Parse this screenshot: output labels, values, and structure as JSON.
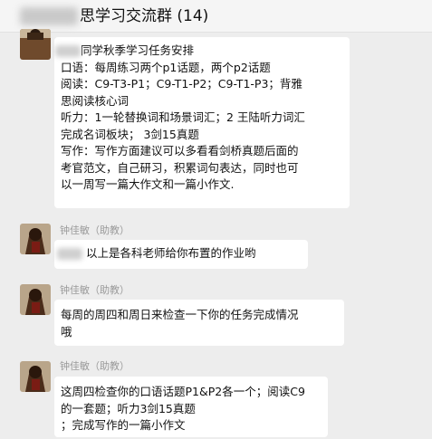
{
  "window": {
    "title": "思学习交流群 (14)"
  },
  "messages": [
    {
      "sender": "",
      "lines": [
        "同学秋季学习任务安排",
        "口语：每周练习两个p1话题，两个p2话题",
        "阅读：C9-T3-P1；C9-T1-P2；C9-T1-P3；背雅",
        "思阅读核心词",
        "听力：1一轮替换词和场景词汇；2 王陆听力词汇",
        "完成名词板块；  3剑15真题",
        "写作：写作方面建议可以多看看剑桥真题后面的",
        "考官范文，自己研习，积累词句表达，同时也可",
        "以一周写一篇大作文和一篇小作文."
      ]
    },
    {
      "sender": "钟佳敏（助教）",
      "lines": [
        "以上是各科老师给你布置的作业哟"
      ]
    },
    {
      "sender": "钟佳敏（助教）",
      "lines": [
        "每周的周四和周日来检查一下你的任务完成情况",
        "哦"
      ]
    },
    {
      "sender": "钟佳敏（助教）",
      "lines": [
        "这周四检查你的口语话题P1&P2各一个；阅读C9",
        "的一套题；听力3剑15真题",
        "；完成写作的一篇小作文"
      ]
    }
  ]
}
